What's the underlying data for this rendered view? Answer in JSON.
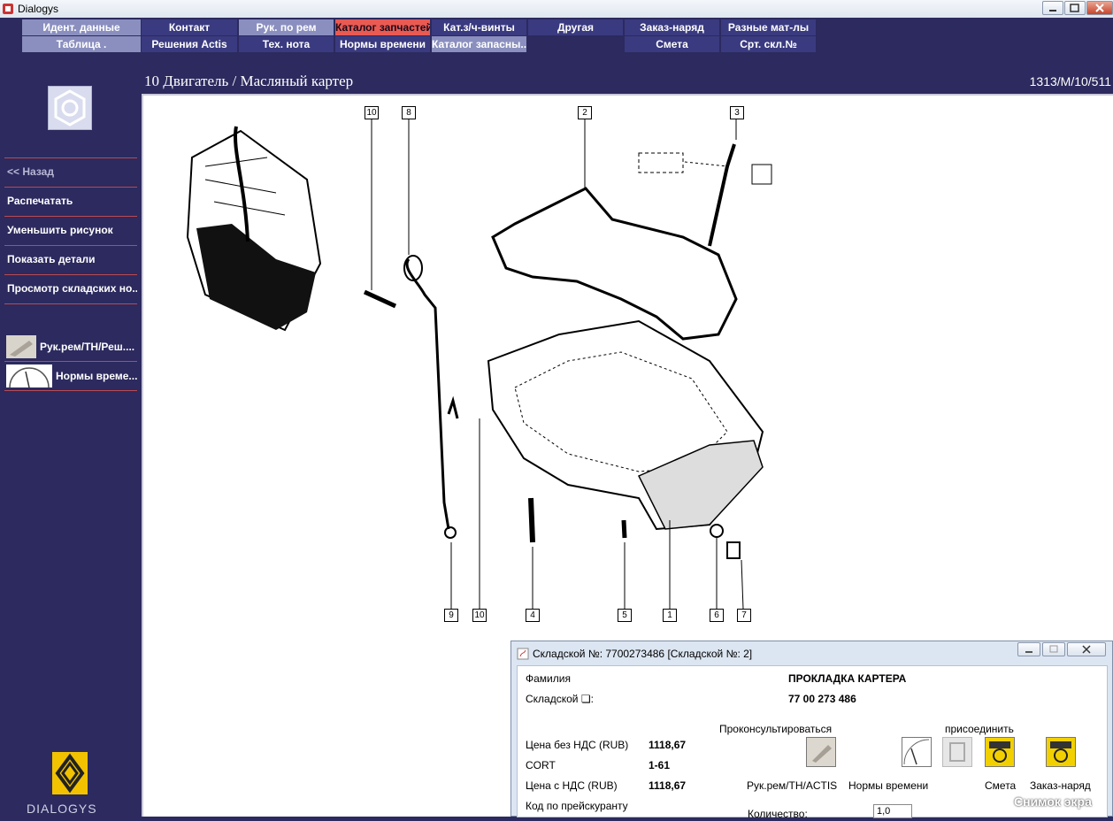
{
  "window": {
    "title": "Dialogys"
  },
  "menu": {
    "row1": [
      "Идент. данные",
      "Контакт",
      "Рук. по рем",
      "Каталог запчастей",
      "Кат.з/ч-винты",
      "Другая",
      "Заказ-наряд",
      "Разные мат-лы"
    ],
    "row2": [
      "Таблица .",
      "Решения Actis",
      "Тех. нота",
      "Нормы времени",
      "Каталог запасны...",
      "Смета",
      "Срт. скл.№"
    ]
  },
  "page": {
    "title": "10 Двигатель / Масляный картер",
    "code": "1313/M/10/511"
  },
  "sidebar": {
    "back": "<< Назад",
    "items": [
      "Распечатать",
      "Уменьшить рисунок",
      "Показать детали",
      "Просмотр складских но..."
    ],
    "links": [
      "Рук.рем/ТН/Реш....",
      "Нормы време..."
    ],
    "brand": "DIALOGYS"
  },
  "callouts": [
    "10",
    "8",
    "2",
    "3",
    "9",
    "10",
    "4",
    "5",
    "1",
    "6",
    "7"
  ],
  "dialog": {
    "title": "Складской №: 7700273486 [Складской №: 2]",
    "family_label": "Фамилия",
    "family_value": "ПРОКЛАДКА КАРТЕРА",
    "stock_label": "Складской ❏:",
    "stock_value": "77 00 273 486",
    "consult_label": "Проконсультироваться",
    "attach_label": "присоединить",
    "price_net_label": "Цена без НДС (RUB)",
    "price_net_value": "1118,67",
    "cort_label": "CORT",
    "cort_value": "1-61",
    "price_vat_label": "Цена с НДС (RUB)",
    "price_vat_value": "1118,67",
    "price_code_label": "Код по прейскуранту",
    "qty_label": "Количество:",
    "qty_value": "1,0",
    "actions": [
      "Рук.рем/ТН/ACTIS",
      "Нормы времени",
      "Смета",
      "Заказ-наряд"
    ]
  },
  "watermark": "Снимок экра"
}
